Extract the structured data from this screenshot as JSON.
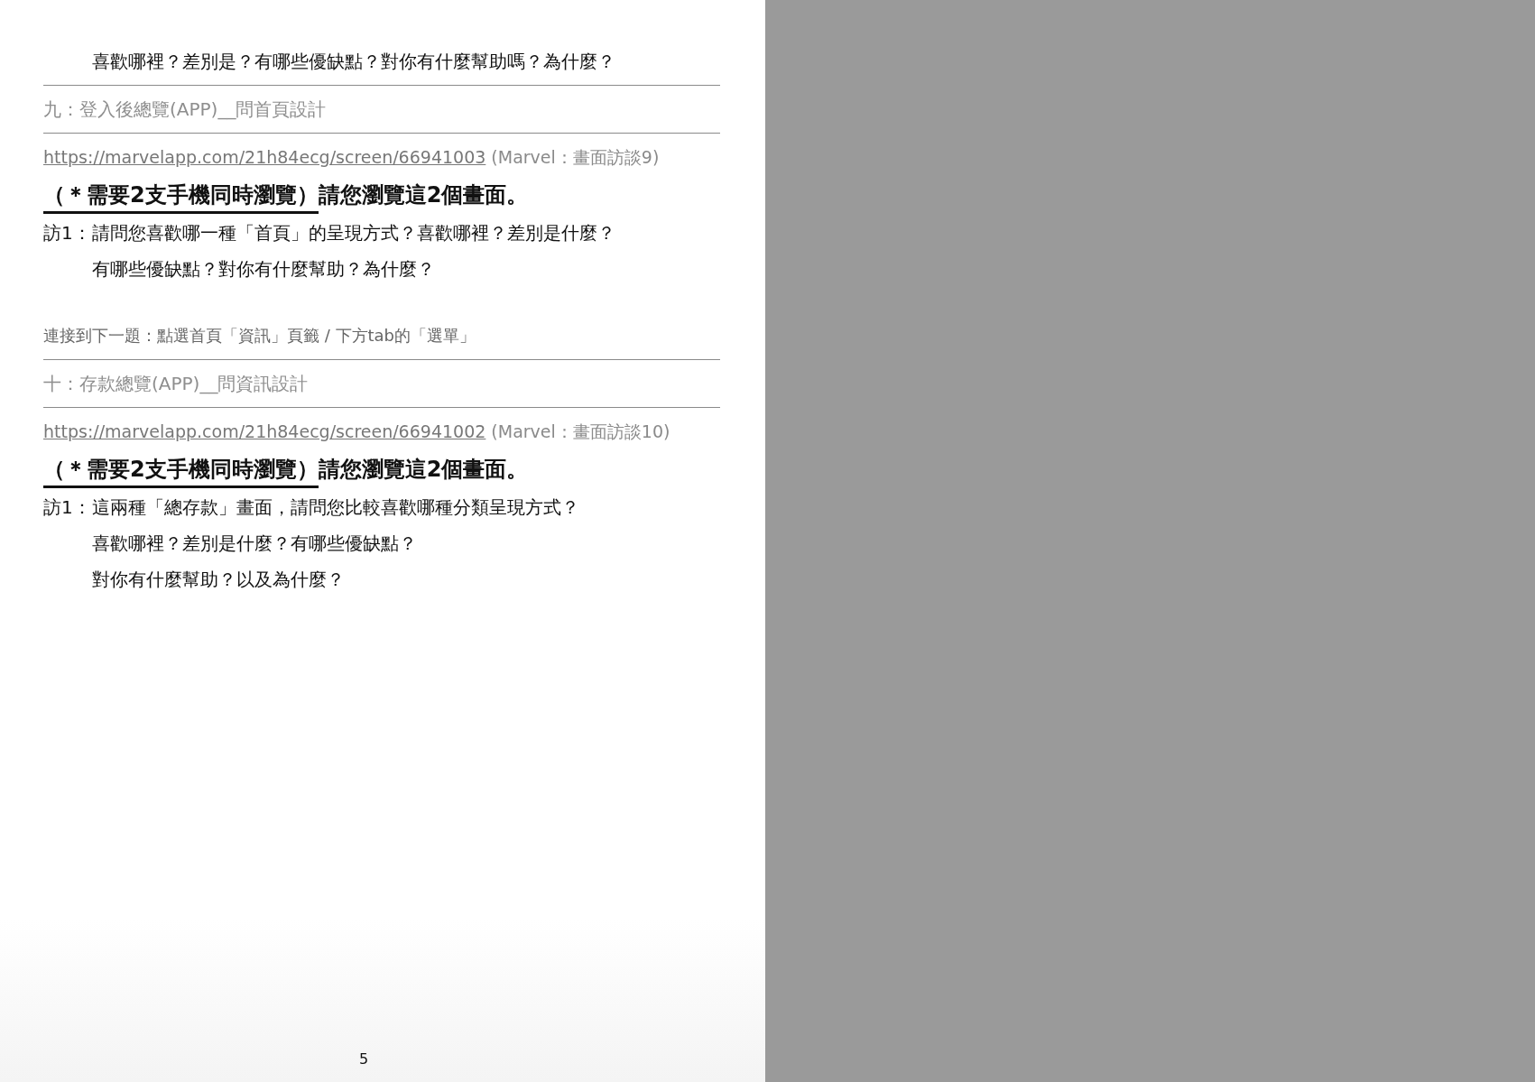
{
  "continuation_line": "喜歡哪裡？差別是？有哪些優缺點？對你有什麼幫助嗎？為什麼？",
  "sections": [
    {
      "title": "九：登入後總覽(APP)__問首頁設計",
      "url": "https://marvelapp.com/21h84ecg/screen/66941003",
      "url_note": "(Marvel：畫面訪談9)",
      "notice_underlined": "（＊需要2支手機同時瀏覽）",
      "notice_rest": "請您瀏覽這2個畫面。",
      "question_label": "訪1：",
      "question_lines": [
        "請問您喜歡哪一種「首頁」的呈現方式？喜歡哪裡？差別是什麼？",
        "有哪些優缺點？對你有什麼幫助？為什麼？"
      ],
      "next_note": "連接到下一題：點選首頁「資訊」頁籤 / 下方tab的「選單」"
    },
    {
      "title": "十：存款總覽(APP)__問資訊設計",
      "url": "https://marvelapp.com/21h84ecg/screen/66941002 ",
      "url_note": "(Marvel：畫面訪談10)",
      "notice_underlined": "（＊需要2支手機同時瀏覽）",
      "notice_rest": "請您瀏覽這2個畫面。",
      "question_label": "訪1：",
      "question_lines": [
        "這兩種「總存款」畫面，請問您比較喜歡哪種分類呈現方式？",
        "喜歡哪裡？差別是什麼？有哪些優缺點？",
        "對你有什麼幫助？以及為什麼？"
      ]
    }
  ],
  "page_number": "5"
}
